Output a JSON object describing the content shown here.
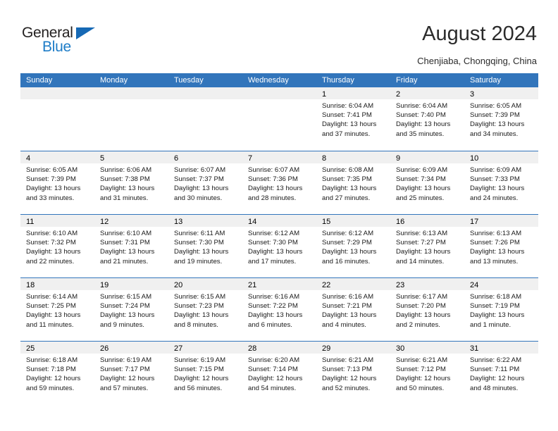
{
  "brand": {
    "name_top": "General",
    "name_bottom": "Blue",
    "triangle_color": "#1669b5",
    "blue_color": "#1d7cc7"
  },
  "header": {
    "title": "August 2024",
    "subtitle": "Chenjiaba, Chongqing, China"
  },
  "theme": {
    "header_blue": "#3275bb",
    "daynum_strip": "#f0f0f0",
    "text": "#000000"
  },
  "calendar": {
    "weekday_headers": [
      "Sunday",
      "Monday",
      "Tuesday",
      "Wednesday",
      "Thursday",
      "Friday",
      "Saturday"
    ],
    "weeks": [
      [
        {
          "day": "",
          "lines": []
        },
        {
          "day": "",
          "lines": []
        },
        {
          "day": "",
          "lines": []
        },
        {
          "day": "",
          "lines": []
        },
        {
          "day": "1",
          "lines": [
            "Sunrise: 6:04 AM",
            "Sunset: 7:41 PM",
            "Daylight: 13 hours",
            "and 37 minutes."
          ]
        },
        {
          "day": "2",
          "lines": [
            "Sunrise: 6:04 AM",
            "Sunset: 7:40 PM",
            "Daylight: 13 hours",
            "and 35 minutes."
          ]
        },
        {
          "day": "3",
          "lines": [
            "Sunrise: 6:05 AM",
            "Sunset: 7:39 PM",
            "Daylight: 13 hours",
            "and 34 minutes."
          ]
        }
      ],
      [
        {
          "day": "4",
          "lines": [
            "Sunrise: 6:05 AM",
            "Sunset: 7:39 PM",
            "Daylight: 13 hours",
            "and 33 minutes."
          ]
        },
        {
          "day": "5",
          "lines": [
            "Sunrise: 6:06 AM",
            "Sunset: 7:38 PM",
            "Daylight: 13 hours",
            "and 31 minutes."
          ]
        },
        {
          "day": "6",
          "lines": [
            "Sunrise: 6:07 AM",
            "Sunset: 7:37 PM",
            "Daylight: 13 hours",
            "and 30 minutes."
          ]
        },
        {
          "day": "7",
          "lines": [
            "Sunrise: 6:07 AM",
            "Sunset: 7:36 PM",
            "Daylight: 13 hours",
            "and 28 minutes."
          ]
        },
        {
          "day": "8",
          "lines": [
            "Sunrise: 6:08 AM",
            "Sunset: 7:35 PM",
            "Daylight: 13 hours",
            "and 27 minutes."
          ]
        },
        {
          "day": "9",
          "lines": [
            "Sunrise: 6:09 AM",
            "Sunset: 7:34 PM",
            "Daylight: 13 hours",
            "and 25 minutes."
          ]
        },
        {
          "day": "10",
          "lines": [
            "Sunrise: 6:09 AM",
            "Sunset: 7:33 PM",
            "Daylight: 13 hours",
            "and 24 minutes."
          ]
        }
      ],
      [
        {
          "day": "11",
          "lines": [
            "Sunrise: 6:10 AM",
            "Sunset: 7:32 PM",
            "Daylight: 13 hours",
            "and 22 minutes."
          ]
        },
        {
          "day": "12",
          "lines": [
            "Sunrise: 6:10 AM",
            "Sunset: 7:31 PM",
            "Daylight: 13 hours",
            "and 21 minutes."
          ]
        },
        {
          "day": "13",
          "lines": [
            "Sunrise: 6:11 AM",
            "Sunset: 7:30 PM",
            "Daylight: 13 hours",
            "and 19 minutes."
          ]
        },
        {
          "day": "14",
          "lines": [
            "Sunrise: 6:12 AM",
            "Sunset: 7:30 PM",
            "Daylight: 13 hours",
            "and 17 minutes."
          ]
        },
        {
          "day": "15",
          "lines": [
            "Sunrise: 6:12 AM",
            "Sunset: 7:29 PM",
            "Daylight: 13 hours",
            "and 16 minutes."
          ]
        },
        {
          "day": "16",
          "lines": [
            "Sunrise: 6:13 AM",
            "Sunset: 7:27 PM",
            "Daylight: 13 hours",
            "and 14 minutes."
          ]
        },
        {
          "day": "17",
          "lines": [
            "Sunrise: 6:13 AM",
            "Sunset: 7:26 PM",
            "Daylight: 13 hours",
            "and 13 minutes."
          ]
        }
      ],
      [
        {
          "day": "18",
          "lines": [
            "Sunrise: 6:14 AM",
            "Sunset: 7:25 PM",
            "Daylight: 13 hours",
            "and 11 minutes."
          ]
        },
        {
          "day": "19",
          "lines": [
            "Sunrise: 6:15 AM",
            "Sunset: 7:24 PM",
            "Daylight: 13 hours",
            "and 9 minutes."
          ]
        },
        {
          "day": "20",
          "lines": [
            "Sunrise: 6:15 AM",
            "Sunset: 7:23 PM",
            "Daylight: 13 hours",
            "and 8 minutes."
          ]
        },
        {
          "day": "21",
          "lines": [
            "Sunrise: 6:16 AM",
            "Sunset: 7:22 PM",
            "Daylight: 13 hours",
            "and 6 minutes."
          ]
        },
        {
          "day": "22",
          "lines": [
            "Sunrise: 6:16 AM",
            "Sunset: 7:21 PM",
            "Daylight: 13 hours",
            "and 4 minutes."
          ]
        },
        {
          "day": "23",
          "lines": [
            "Sunrise: 6:17 AM",
            "Sunset: 7:20 PM",
            "Daylight: 13 hours",
            "and 2 minutes."
          ]
        },
        {
          "day": "24",
          "lines": [
            "Sunrise: 6:18 AM",
            "Sunset: 7:19 PM",
            "Daylight: 13 hours",
            "and 1 minute."
          ]
        }
      ],
      [
        {
          "day": "25",
          "lines": [
            "Sunrise: 6:18 AM",
            "Sunset: 7:18 PM",
            "Daylight: 12 hours",
            "and 59 minutes."
          ]
        },
        {
          "day": "26",
          "lines": [
            "Sunrise: 6:19 AM",
            "Sunset: 7:17 PM",
            "Daylight: 12 hours",
            "and 57 minutes."
          ]
        },
        {
          "day": "27",
          "lines": [
            "Sunrise: 6:19 AM",
            "Sunset: 7:15 PM",
            "Daylight: 12 hours",
            "and 56 minutes."
          ]
        },
        {
          "day": "28",
          "lines": [
            "Sunrise: 6:20 AM",
            "Sunset: 7:14 PM",
            "Daylight: 12 hours",
            "and 54 minutes."
          ]
        },
        {
          "day": "29",
          "lines": [
            "Sunrise: 6:21 AM",
            "Sunset: 7:13 PM",
            "Daylight: 12 hours",
            "and 52 minutes."
          ]
        },
        {
          "day": "30",
          "lines": [
            "Sunrise: 6:21 AM",
            "Sunset: 7:12 PM",
            "Daylight: 12 hours",
            "and 50 minutes."
          ]
        },
        {
          "day": "31",
          "lines": [
            "Sunrise: 6:22 AM",
            "Sunset: 7:11 PM",
            "Daylight: 12 hours",
            "and 48 minutes."
          ]
        }
      ]
    ]
  }
}
